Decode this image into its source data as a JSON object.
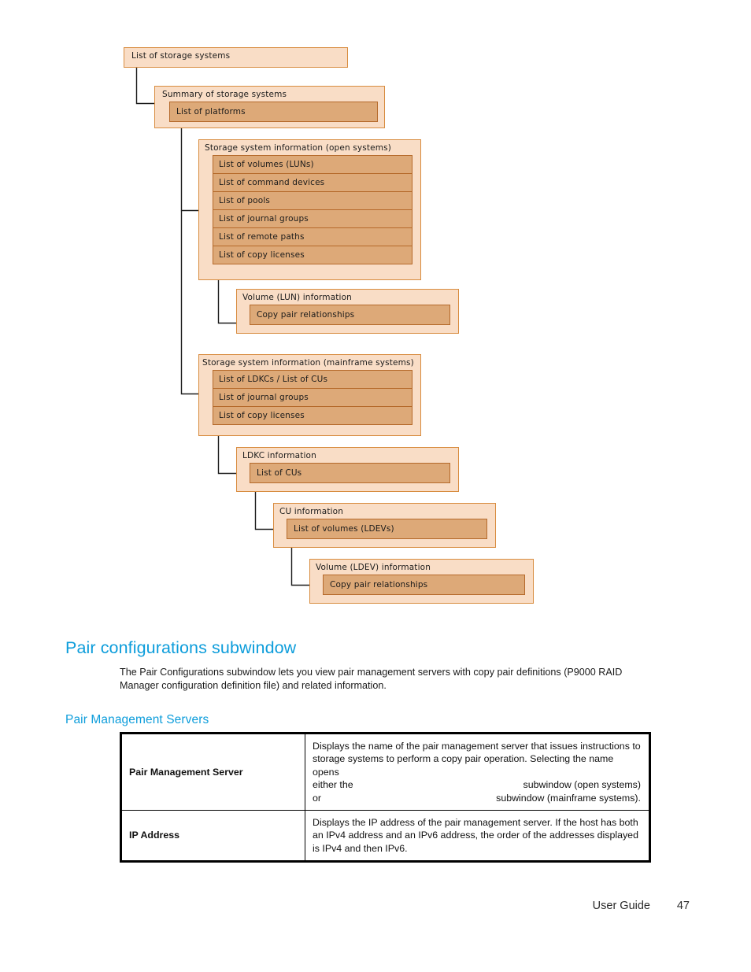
{
  "page": {
    "footer_label": "User Guide",
    "page_number": "47"
  },
  "colors": {
    "heading_blue": "#0d9ddb",
    "node_fill": "#f9ddc6",
    "node_border": "#d88c3f",
    "item_fill": "#dda978",
    "item_border": "#b5692a"
  },
  "diagram": {
    "name": "storage systems navigation hierarchy",
    "nodes": [
      {
        "id": "list-of-storage-systems",
        "title": "List of storage systems",
        "items": []
      },
      {
        "id": "summary-of-storage-systems",
        "title": "Summary of storage systems",
        "items": [
          "List of platforms"
        ]
      },
      {
        "id": "storage-system-information-open",
        "title": "Storage system information (open systems)",
        "items": [
          "List of volumes (LUNs)",
          "List of command devices",
          "List of pools",
          "List of journal groups",
          "List of remote paths",
          "List of copy licenses"
        ]
      },
      {
        "id": "volume-lun-information",
        "title": "Volume (LUN) information",
        "items": [
          "Copy pair relationships"
        ]
      },
      {
        "id": "storage-system-information-mainframe",
        "title": "Storage system information (mainframe systems)",
        "items": [
          "List of LDKCs / List of CUs",
          "List of journal groups",
          "List of copy licenses"
        ]
      },
      {
        "id": "ldkc-information",
        "title": "LDKC information",
        "items": [
          "List of CUs"
        ]
      },
      {
        "id": "cu-information",
        "title": "CU information",
        "items": [
          "List of volumes (LDEVs)"
        ]
      },
      {
        "id": "volume-ldev-information",
        "title": "Volume (LDEV) information",
        "items": [
          "Copy pair relationships"
        ]
      }
    ]
  },
  "section": {
    "heading": "Pair configurations subwindow",
    "intro": "The Pair Configurations subwindow lets you view pair management servers with copy pair definitions (P9000 RAID Manager configuration definition file) and related information.",
    "subheading": "Pair Management Servers"
  },
  "table": {
    "rows": [
      {
        "label": "Pair Management Server",
        "desc_line1": "Displays the name of the pair management server that issues instructions to",
        "desc_line2": "storage systems to perform a copy pair operation. Selecting the name opens",
        "desc_line3_left": "either the",
        "desc_line3_right": "subwindow (open systems)",
        "desc_line4_left": "or",
        "desc_line4_right": "subwindow (mainframe systems)."
      },
      {
        "label": "IP Address",
        "desc_line1": "Displays the IP address of the pair management server. If the host has both",
        "desc_line2": "an IPv4 address and an IPv6 address, the order of the addresses displayed",
        "desc_line3_left": "is IPv4 and then IPv6.",
        "desc_line3_right": "",
        "desc_line4_left": "",
        "desc_line4_right": ""
      }
    ]
  }
}
